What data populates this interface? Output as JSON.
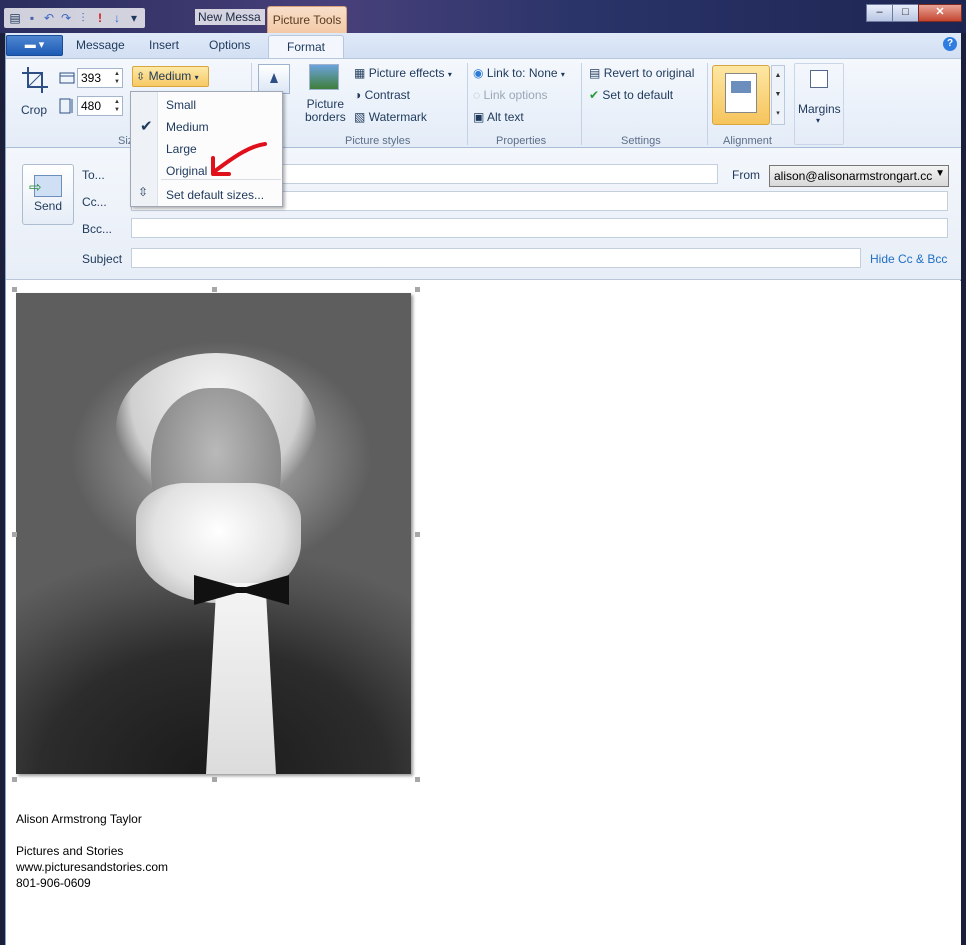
{
  "window": {
    "title": "New Messa",
    "context_tab": "Picture Tools",
    "minimize": "–",
    "maximize": "□",
    "close": "✕"
  },
  "ribbon_tabs": {
    "file": "▬ ▾",
    "message": "Message",
    "insert": "Insert",
    "options": "Options",
    "format": "Format",
    "help": "?"
  },
  "ribbon": {
    "crop": "Crop",
    "width_value": "393",
    "height_value": "480",
    "size_preset": "Medium",
    "size_group": "Siz",
    "picture_borders": "Picture\nborders",
    "picture_styles_group": "Picture styles",
    "picture_effects": "Picture effects",
    "contrast": "Contrast",
    "watermark": "Watermark",
    "link_to": "Link to: None",
    "link_options": "Link options",
    "alt_text": "Alt text",
    "properties_group": "Properties",
    "revert": "Revert to original",
    "set_default": "Set to default",
    "settings_group": "Settings",
    "alignment_group": "Alignment",
    "margins": "Margins"
  },
  "size_menu": {
    "items": [
      "Small",
      "Medium",
      "Large",
      "Original"
    ],
    "selected": "Medium",
    "set_default_sizes": "Set default sizes..."
  },
  "header": {
    "send": "Send",
    "to": "To...",
    "cc": "Cc...",
    "bcc": "Bcc...",
    "subject": "Subject",
    "from_label": "From",
    "from_value": "alison@alisonarmstrongart.cc",
    "hide_cc_bcc": "Hide Cc & Bcc"
  },
  "signature": {
    "name": "Alison Armstrong Taylor",
    "company": "Pictures and Stories",
    "website": "www.picturesandstories.com",
    "phone": "801-906-0609"
  },
  "colors": {
    "accent": "#f7c964",
    "annotation_arrow": "#e0101a",
    "link": "#1f6fc3"
  }
}
